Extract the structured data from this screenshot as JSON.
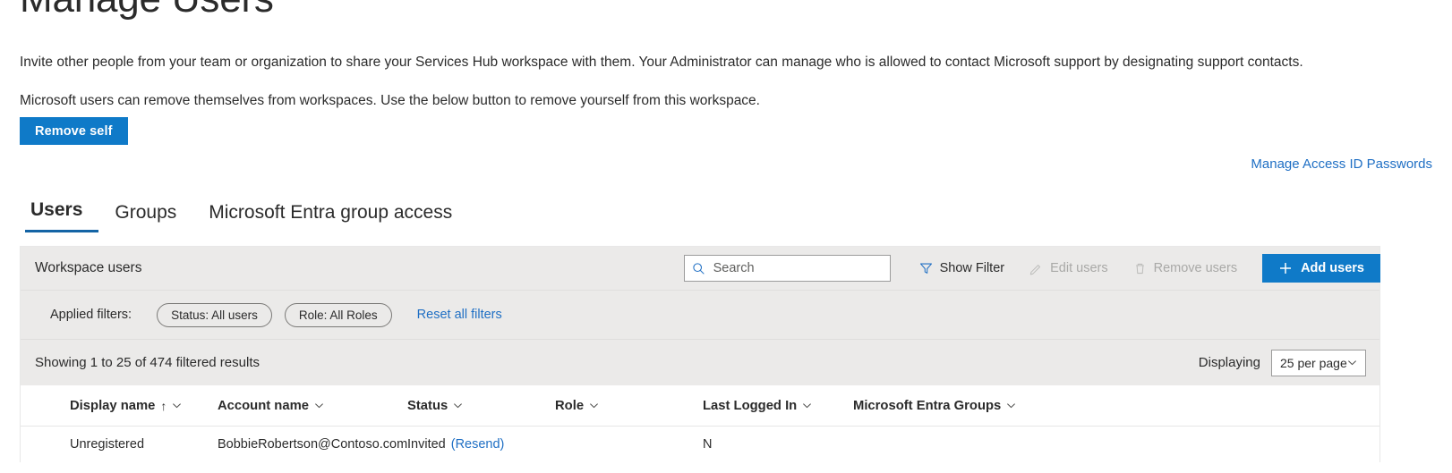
{
  "header": {
    "title": "Manage Users",
    "intro_line_1": "Invite other people from your team or organization to share your Services Hub workspace with them. Your Administrator can manage who is allowed to contact Microsoft support by designating support contacts.",
    "intro_line_2": "Microsoft users can remove themselves from workspaces. Use the below button to remove yourself from this workspace.",
    "remove_self_label": "Remove self",
    "manage_access_link": "Manage Access ID Passwords"
  },
  "tabs": [
    {
      "label": "Users",
      "active": true
    },
    {
      "label": "Groups",
      "active": false
    },
    {
      "label": "Microsoft Entra group access",
      "active": false
    }
  ],
  "toolbar": {
    "title": "Workspace users",
    "search_placeholder": "Search",
    "search_value": "",
    "show_filter_label": "Show Filter",
    "edit_users_label": "Edit users",
    "remove_users_label": "Remove users",
    "add_users_label": "Add users"
  },
  "filters": {
    "label": "Applied filters:",
    "chips": [
      "Status: All users",
      "Role: All Roles"
    ],
    "reset_label": "Reset all filters"
  },
  "results": {
    "showing_text": "Showing 1 to 25 of 474 filtered results",
    "displaying_label": "Displaying",
    "per_page_value": "25 per page"
  },
  "table": {
    "columns": [
      {
        "label": "Display name",
        "sorted": "asc"
      },
      {
        "label": "Account name",
        "sorted": ""
      },
      {
        "label": "Status",
        "sorted": ""
      },
      {
        "label": "Role",
        "sorted": ""
      },
      {
        "label": "Last Logged In",
        "sorted": ""
      },
      {
        "label": "Microsoft Entra Groups",
        "sorted": ""
      }
    ],
    "rows": [
      {
        "display_name": "Unregistered",
        "account_name": "BobbieRobertson@Contoso.com",
        "status": "Invited",
        "status_action": "(Resend)",
        "role": "",
        "last_logged_in": "N",
        "entra_groups": ""
      }
    ]
  },
  "colors": {
    "accent_blue": "#0f7ac8",
    "link_blue": "#1f6fc4",
    "panel_grey": "#ebeae9",
    "tab_underline": "#1464a5",
    "disabled_grey": "#a9a9a7"
  },
  "icons": {
    "search": "search-icon",
    "filter": "filter-icon",
    "edit": "pencil-icon",
    "remove": "trash-icon",
    "add": "plus-icon",
    "sort_asc": "arrow-up-icon",
    "chevron": "chevron-down-icon"
  }
}
